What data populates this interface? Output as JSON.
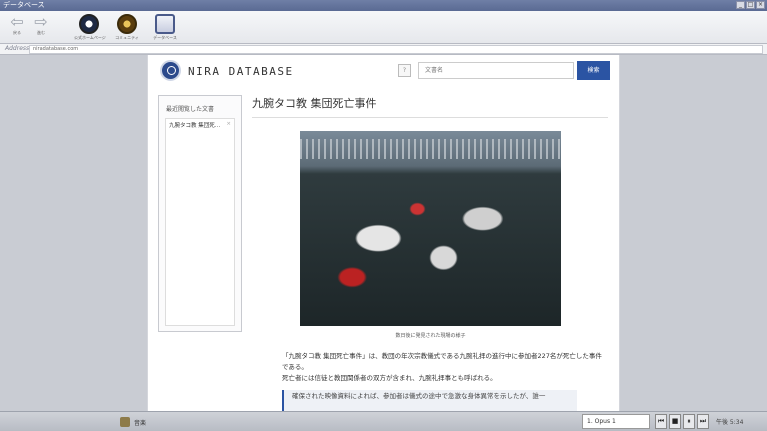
{
  "window": {
    "title": "データベース"
  },
  "toolbar": {
    "back_label": "戻る",
    "forward_label": "進む",
    "tools": [
      {
        "label": "公式ホームページ",
        "icon": "emblem-icon"
      },
      {
        "label": "コミュニティ",
        "icon": "community-icon"
      },
      {
        "label": "データベース",
        "icon": "database-icon"
      }
    ]
  },
  "address": {
    "label": "Address",
    "url": "niradatabase.com"
  },
  "site": {
    "title": "NIRA DATABASE",
    "help": "?",
    "search_placeholder": "文書名",
    "search_button": "検索"
  },
  "sidebar": {
    "title": "最近閲覧した文書",
    "items": [
      {
        "label": "九腕タコ教 集団死…",
        "close": "×"
      }
    ]
  },
  "article": {
    "title": "九腕タコ教 集団死亡事件",
    "caption": "数日後に発見された現場の様子",
    "body": [
      "「九腕タコ教 集団死亡事件」は、教団の年次宗教儀式である九腕礼拝の進行中に参加者227名が死亡した事件である。",
      "死亡者には信徒と教団関係者の双方が含まれ、九腕礼拝事とも呼ばれる。"
    ],
    "quote": "確保された映像資料によれば、参加者は儀式の途中で急激な身体異常を示したが、誰一"
  },
  "taskbar": {
    "task_label": "音楽",
    "track": "1. Opus 1",
    "controls": [
      "⏮",
      "■",
      "⏸",
      "⏭"
    ],
    "clock": "午後 5:34"
  }
}
